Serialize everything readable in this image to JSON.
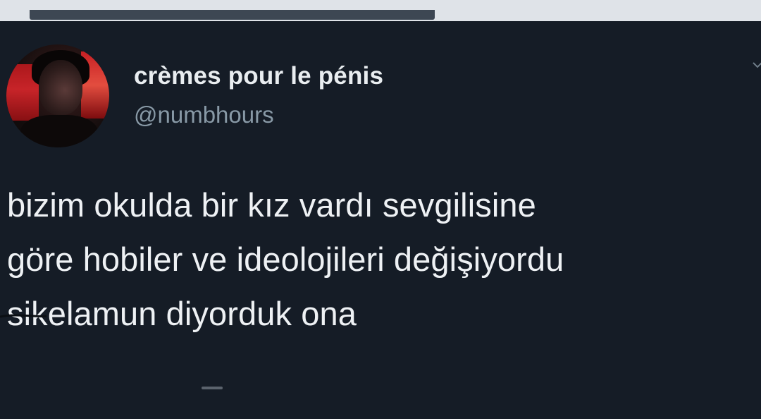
{
  "tweet": {
    "display_name": "crèmes pour le pénis",
    "handle": "@numbhours",
    "text_lines": [
      "bizim okulda bir kız vardı sevgilisine",
      "göre hobiler ve ideolojileri değişiyordu",
      "sikelamun diyorduk ona"
    ]
  },
  "colors": {
    "background": "#151c26",
    "name": "#e9edf0",
    "handle": "#8899a6",
    "text": "#eef1f4",
    "avatar_accent": "#c72024"
  },
  "icons": {
    "caret": "chevron-down-icon"
  }
}
